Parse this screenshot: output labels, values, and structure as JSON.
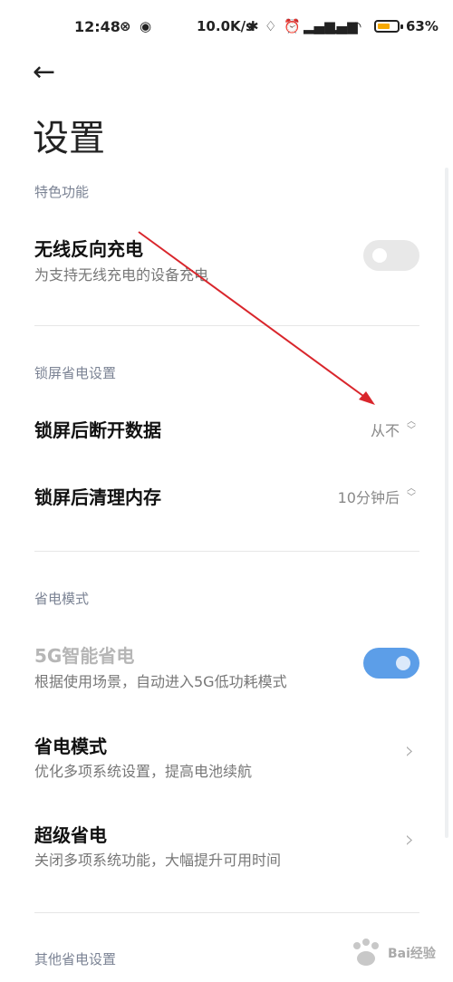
{
  "status": {
    "time": "12:48",
    "speed": "10.0K/s",
    "battery_pct": "63%",
    "battery_level": 0.63,
    "icons": [
      "sync-icon",
      "globe-icon",
      "bluetooth-icon",
      "bell-off-icon",
      "alarm-icon",
      "hd-signal-icon",
      "hd-signal-icon",
      "wifi-icon"
    ]
  },
  "page": {
    "title": "设置"
  },
  "sections": {
    "featured": "特色功能",
    "lock": "锁屏省电设置",
    "mode": "省电模式",
    "other": "其他省电设置"
  },
  "rows": {
    "wireless": {
      "title": "无线反向充电",
      "sub": "为支持无线充电的设备充电",
      "state": "off"
    },
    "disconnect": {
      "title": "锁屏后断开数据",
      "value": "从不"
    },
    "clean": {
      "title": "锁屏后清理内存",
      "value": "10分钟后"
    },
    "fiveg": {
      "title": "5G智能省电",
      "sub": "根据使用场景，自动进入5G低功耗模式",
      "state": "on"
    },
    "saver": {
      "title": "省电模式",
      "sub": "优化多项系统设置，提高电池续航"
    },
    "super": {
      "title": "超级省电",
      "sub": "关闭多项系统功能，大幅提升可用时间"
    }
  },
  "colors": {
    "accent": "#5c9ee8",
    "arrow": "#d9262c",
    "section": "#7b8394"
  }
}
